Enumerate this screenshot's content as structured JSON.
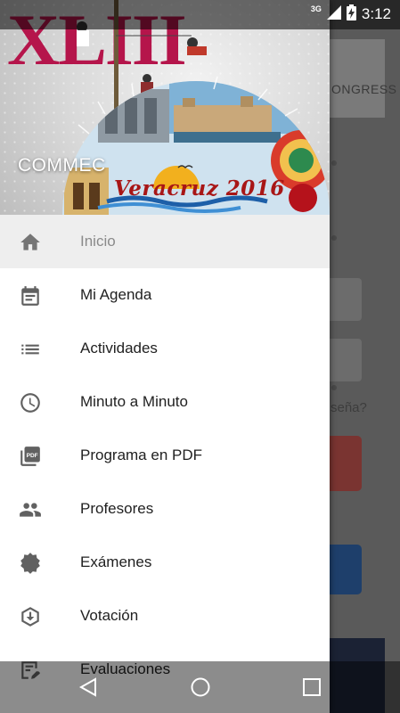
{
  "status_bar": {
    "network": "3G",
    "time": "3:12"
  },
  "background_app": {
    "header_text": "ONGRESS",
    "forgot_text": "seña?"
  },
  "drawer": {
    "header": {
      "logo_text": "XLIII",
      "org_name": "COMMEC",
      "event_caption": "Veracruz 2016"
    },
    "items": [
      {
        "label": "Inicio",
        "icon": "home-icon",
        "active": true
      },
      {
        "label": "Mi Agenda",
        "icon": "agenda-icon"
      },
      {
        "label": "Actividades",
        "icon": "list-icon"
      },
      {
        "label": "Minuto a Minuto",
        "icon": "clock-icon"
      },
      {
        "label": "Programa en PDF",
        "icon": "pdf-icon"
      },
      {
        "label": "Profesores",
        "icon": "people-icon"
      },
      {
        "label": "Exámenes",
        "icon": "badge-icon"
      },
      {
        "label": "Votación",
        "icon": "vote-icon"
      },
      {
        "label": "Evaluaciones",
        "icon": "evaluation-icon"
      }
    ]
  },
  "nav_bar": {
    "buttons": [
      "back-icon",
      "home-circle-icon",
      "recents-icon"
    ]
  },
  "colors": {
    "logo": "#b5154b",
    "icon_gray": "#757575",
    "active_bg": "#eeeeee"
  }
}
